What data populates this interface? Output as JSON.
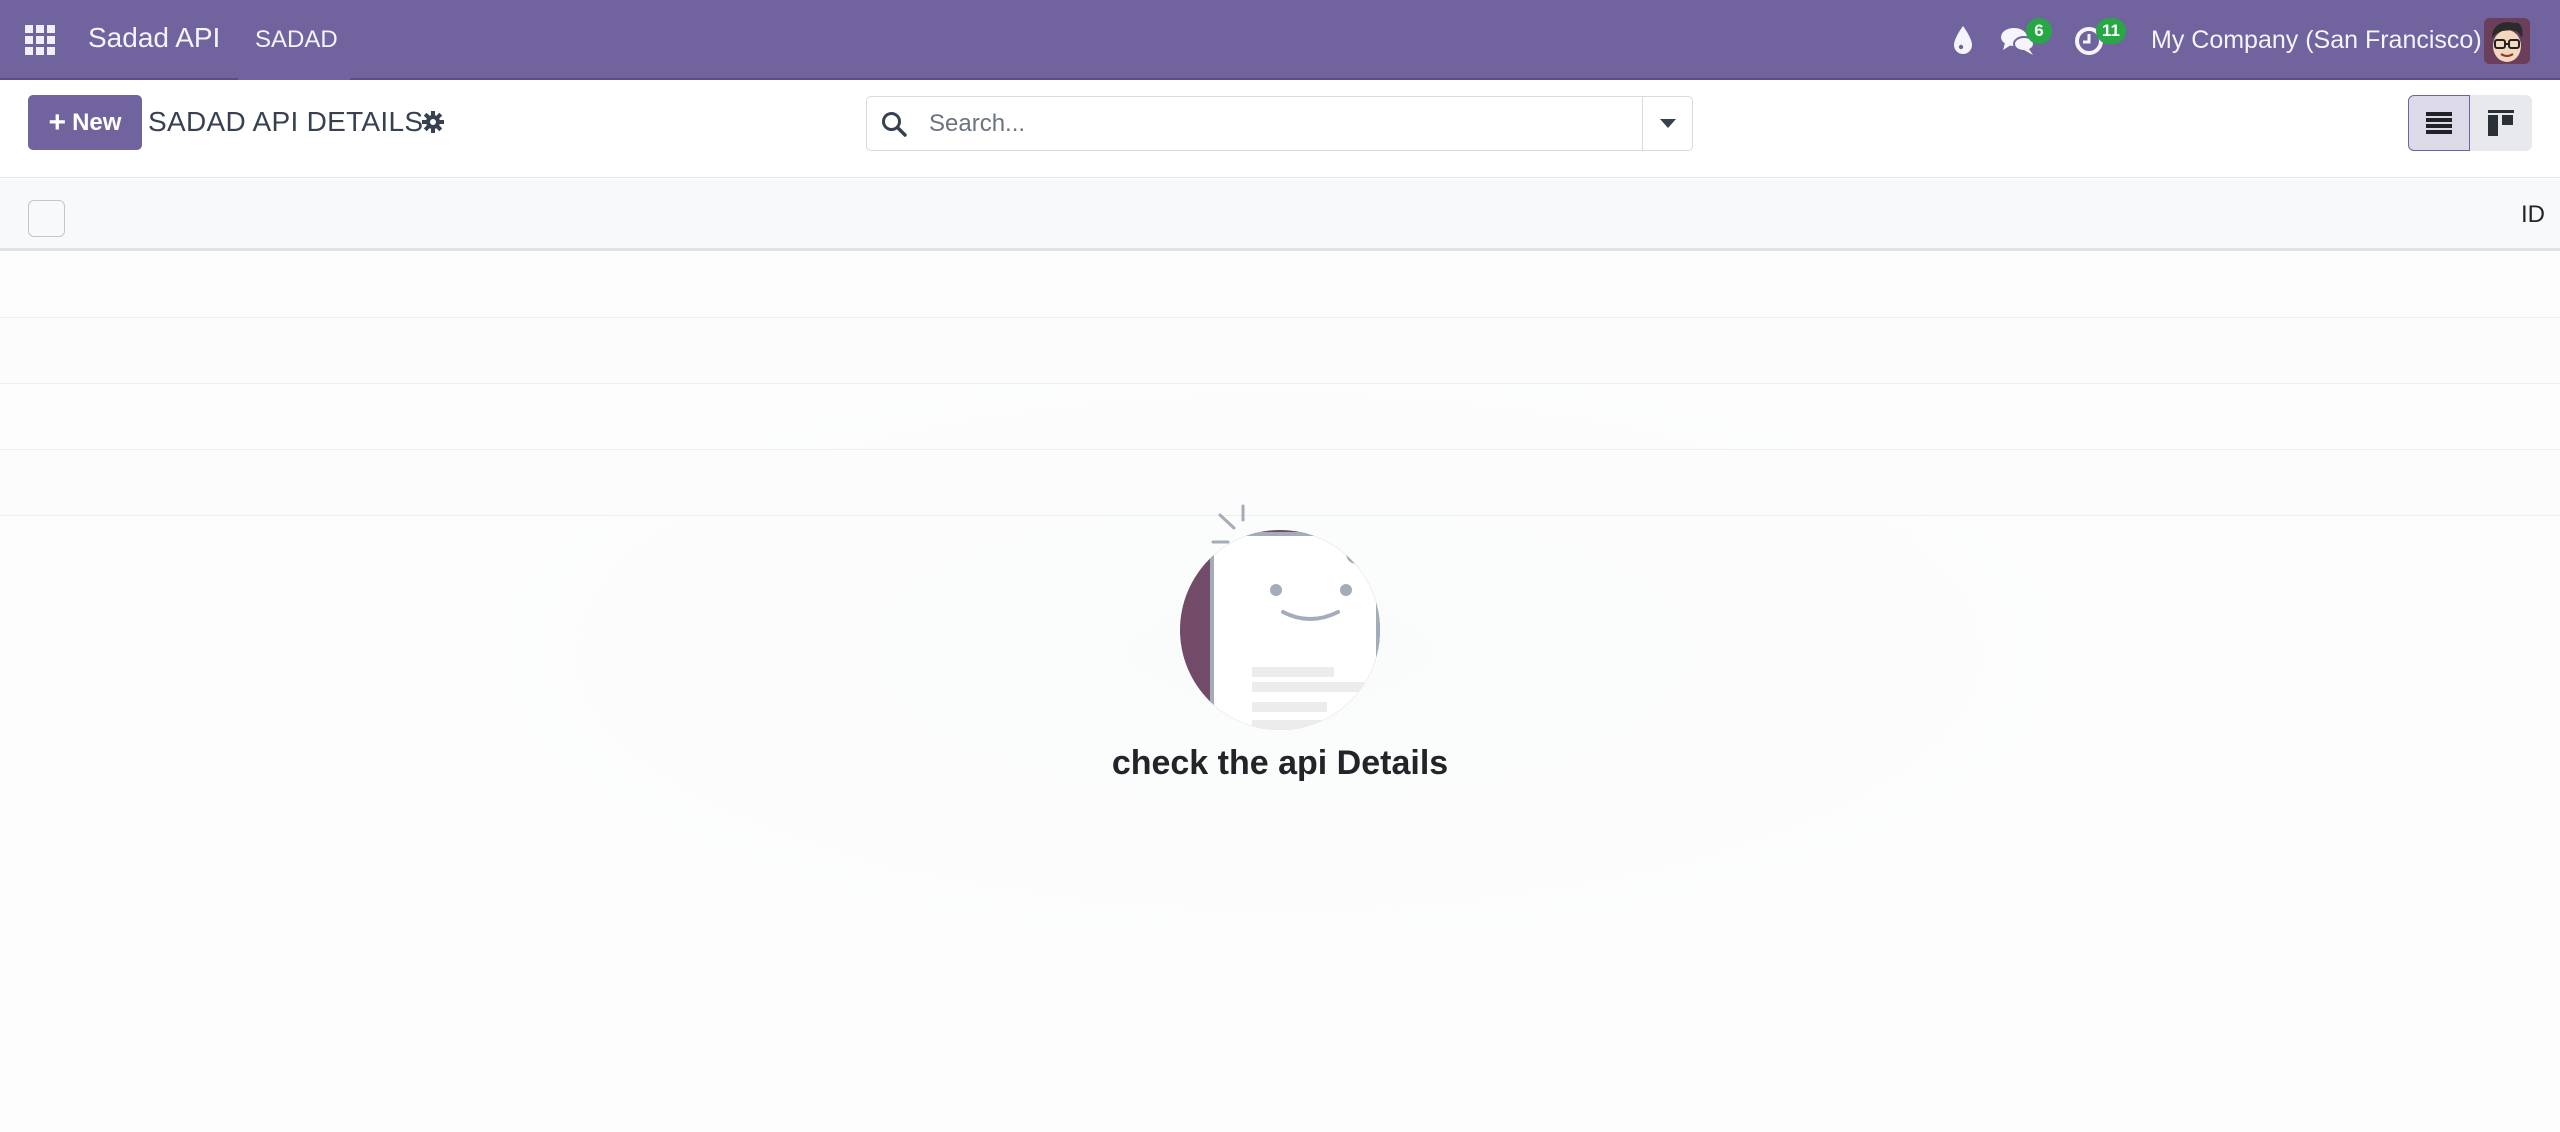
{
  "navbar": {
    "app_name": "Sadad API",
    "menu_items": [
      {
        "label": "SADAD"
      }
    ],
    "messages_count": "6",
    "activities_count": "11",
    "company": "My Company (San Francisco)",
    "icons": [
      "apps-grid-icon",
      "droplet-icon",
      "chat-icon",
      "clock-icon",
      "user-avatar"
    ]
  },
  "control_panel": {
    "new_label": "New",
    "title": "SADAD API DETAILS",
    "search_placeholder": "Search...",
    "views": [
      {
        "name": "list",
        "active": true
      },
      {
        "name": "kanban",
        "active": false
      }
    ]
  },
  "table": {
    "columns": [
      "ID"
    ]
  },
  "empty_state": {
    "message": "check the api Details"
  },
  "colors": {
    "brand": "#71639e",
    "badge": "#28a745",
    "illustration_circle": "#714b67"
  }
}
